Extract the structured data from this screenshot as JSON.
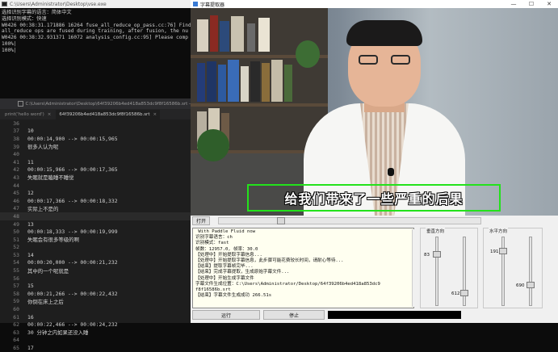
{
  "console": {
    "title": "C:\\Users\\Administrator\\Desktop\\vse.exe",
    "lines": [
      "选择识别字幕的语言：简体中文",
      "选择识别模式：快速",
      "W0426 00:38:31.171886 16264 fuse_all_reduce_op_pass.cc:76] Find",
      "all_reduce ops are fused during training, after fusion, the nu",
      "W0426 00:38:32.931371 16072 analysis_config.cc:95] Please comp",
      "100%|",
      "100%|"
    ]
  },
  "editor": {
    "title": "C:\\Users\\Administrator\\Desktop\\64f39206b4ed418a853dc9f8f16586b.srt -",
    "tabs": [
      {
        "label": "print('hello word')",
        "active": false
      },
      {
        "label": "64f39206b4ed418a853dc9f8f16586b.srt",
        "active": true
      }
    ],
    "rows": [
      {
        "n": "36",
        "text": ""
      },
      {
        "n": "37",
        "text": "10"
      },
      {
        "n": "38",
        "text": "00:00:14,900 --> 00:00:15,965"
      },
      {
        "n": "39",
        "text": "很多人认为呢"
      },
      {
        "n": "40",
        "text": ""
      },
      {
        "n": "41",
        "text": "11"
      },
      {
        "n": "42",
        "text": "00:00:15,966 --> 00:00:17,365"
      },
      {
        "n": "43",
        "text": "失眠就是瞌睡不睡觉"
      },
      {
        "n": "44",
        "text": ""
      },
      {
        "n": "45",
        "text": "12"
      },
      {
        "n": "46",
        "text": "00:00:17,366 --> 00:00:18,332"
      },
      {
        "n": "47",
        "text": "实际上不是的"
      },
      {
        "n": "48",
        "text": ""
      },
      {
        "n": "49",
        "text": "13"
      },
      {
        "n": "50",
        "text": "00:00:18,333 --> 00:00:19,999"
      },
      {
        "n": "51",
        "text": "失眠会有很多等级的啊"
      },
      {
        "n": "52",
        "text": ""
      },
      {
        "n": "53",
        "text": "14"
      },
      {
        "n": "54",
        "text": "00:00:20,000 --> 00:00:21,232"
      },
      {
        "n": "55",
        "text": "其中的一个呢就是"
      },
      {
        "n": "56",
        "text": ""
      },
      {
        "n": "57",
        "text": "15"
      },
      {
        "n": "58",
        "text": "00:00:21,266 --> 00:00:22,432"
      },
      {
        "n": "59",
        "text": "你倒在床上之后"
      },
      {
        "n": "60",
        "text": ""
      },
      {
        "n": "61",
        "text": "16"
      },
      {
        "n": "62",
        "text": "00:00:22,466 --> 00:00:24,232"
      },
      {
        "n": "63",
        "text": "30 分钟之内如果还没入睡"
      },
      {
        "n": "64",
        "text": ""
      },
      {
        "n": "65",
        "text": "17"
      }
    ],
    "current_row": 12
  },
  "tool": {
    "title": "字幕提取器",
    "win_min": "—",
    "win_max": "☐",
    "win_close": "✕",
    "subtitle": "给我们带来了一些严重的后果",
    "open_label": "打开",
    "timeline_fraction": 0.23,
    "log_lines": [
      " With Paddle Fluid now",
      "识别字幕语言：ch",
      "识别模式：fast",
      "帧数：12957.0, 帧率：30.0",
      "【处理中】开始提取字幕信息...",
      "【处理中】开始提取字幕信息，此步骤可能花费较长时间，请耐心等待...",
      "【结束】提取字幕帧完毕...",
      "【结束】完成字幕提取，生成原始字幕文件...",
      "【处理中】开始生成字幕文件",
      "字幕文件生成位置：C:\\Users\\Administrator/Desktop/64f39206b4ed418a853dc9",
      "f8f16586b.srt",
      "【结束】字幕文件生成成功 266.51s"
    ],
    "run_label": "运行",
    "stop_label": "停止",
    "vertical_group": "垂直方向",
    "horizontal_group": "水平方向",
    "vertical_values": {
      "a": 83,
      "b": 612
    },
    "horizontal_values": {
      "a": 191,
      "b": 690
    }
  },
  "colors": {
    "subtitle_box": "#23e21b",
    "console_bg": "#0c0c0c",
    "editor_bg": "#1e1e1e"
  }
}
